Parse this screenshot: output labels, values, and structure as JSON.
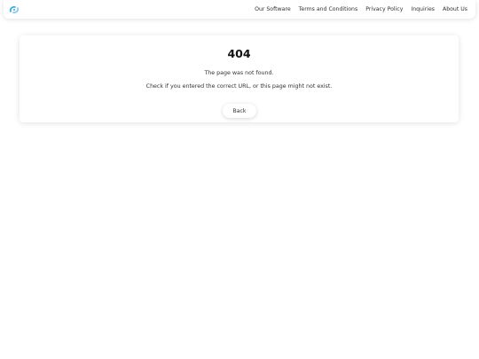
{
  "header": {
    "logo_icon": "swirl-logo-icon",
    "accent_color": "#2aa6e0",
    "nav": [
      {
        "label": "Our Software"
      },
      {
        "label": "Terms and Conditions"
      },
      {
        "label": "Privacy Policy"
      },
      {
        "label": "Inquiries"
      },
      {
        "label": "About Us"
      }
    ]
  },
  "error": {
    "code": "404",
    "message": "The page was not found.",
    "hint": "Check if you entered the correct URL, or this page might not exist.",
    "back_label": "Back"
  }
}
